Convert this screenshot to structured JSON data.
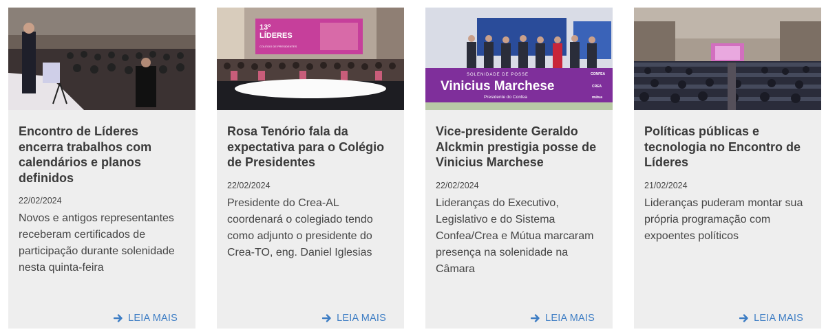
{
  "cards": [
    {
      "title": "Encontro de Líderes encerra trabalhos com calendários e planos definidos",
      "date": "22/02/2024",
      "desc": "Novos e antigos representantes receberam certificados de participação durante solenidade nesta quinta-feira",
      "more": "LEIA MAIS"
    },
    {
      "title": "Rosa Tenório fala da expectativa para o Colégio de Presidentes",
      "date": "22/02/2024",
      "desc": "Presidente do Crea-AL coordenará o colegiado tendo como adjunto o presidente do Crea-TO, eng. Daniel Iglesias",
      "more": "LEIA MAIS",
      "banner": [
        "13º",
        "LÍDERES",
        "COLÉGIO DE PRESIDENTES"
      ]
    },
    {
      "title": "Vice-presidente Geraldo Alckmin prestigia posse de Vinicius Marchese",
      "date": "22/02/2024",
      "desc": "Lideranças do Executivo, Legislativo e do Sistema Confea/Crea e Mútua marcaram presença na solenidade na Câmara",
      "more": "LEIA MAIS",
      "banner": [
        "SOLENIDADE DE POSSE",
        "Vinicius Marchese",
        "Presidente do Confea",
        "CONFEA",
        "CREA",
        "mútua"
      ]
    },
    {
      "title": "Políticas públicas e tecnologia no Encontro de Líderes",
      "date": "21/02/2024",
      "desc": "Lideranças puderam montar sua própria programação com expoentes políticos",
      "more": "LEIA MAIS"
    }
  ],
  "colors": {
    "accent": "#3d7dc4",
    "card_bg": "#eeeeee",
    "title": "#3a3a3a"
  }
}
